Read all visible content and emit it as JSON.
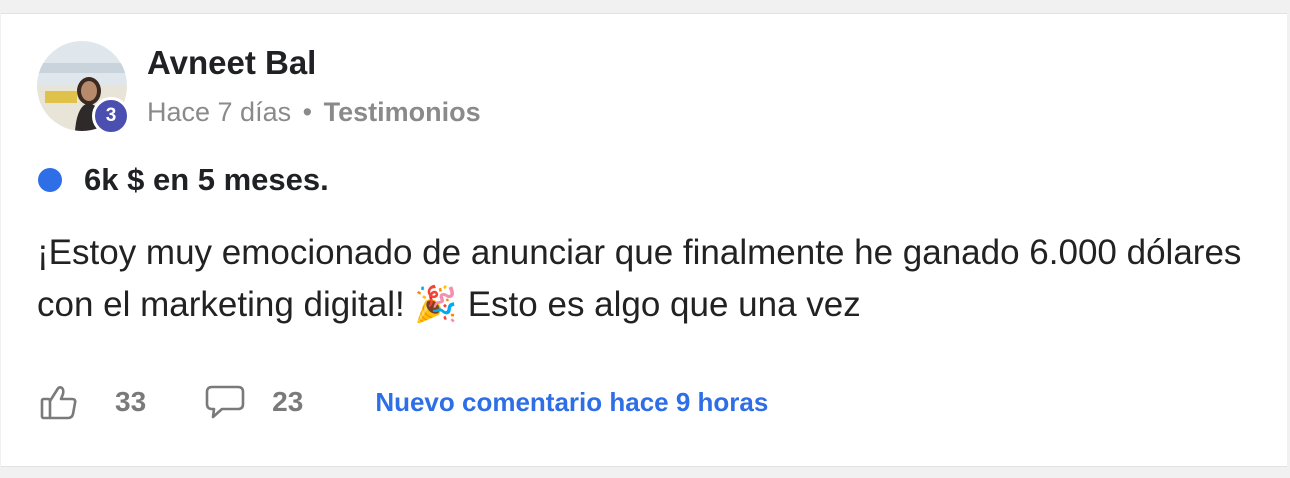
{
  "post": {
    "author": "Avneet Bal",
    "level": "3",
    "time": "Hace 7 días",
    "separator": "•",
    "category": "Testimonios",
    "title": "6k $ en 5 meses.",
    "body": "¡Estoy muy emocionado de anunciar que finalmente he ganado 6.000 dólares con el marketing digital! 🎉 Esto es algo que una vez",
    "likes": "33",
    "comments": "23",
    "new_comment": "Nuevo comentario hace 9 horas"
  },
  "colors": {
    "accent": "#2e6ee6",
    "level_badge": "#4a4fb0",
    "muted": "#8a8a8a"
  },
  "icons": {
    "like": "thumbs-up-icon",
    "comment": "speech-bubble-icon",
    "title_marker": "blue-dot-icon"
  }
}
